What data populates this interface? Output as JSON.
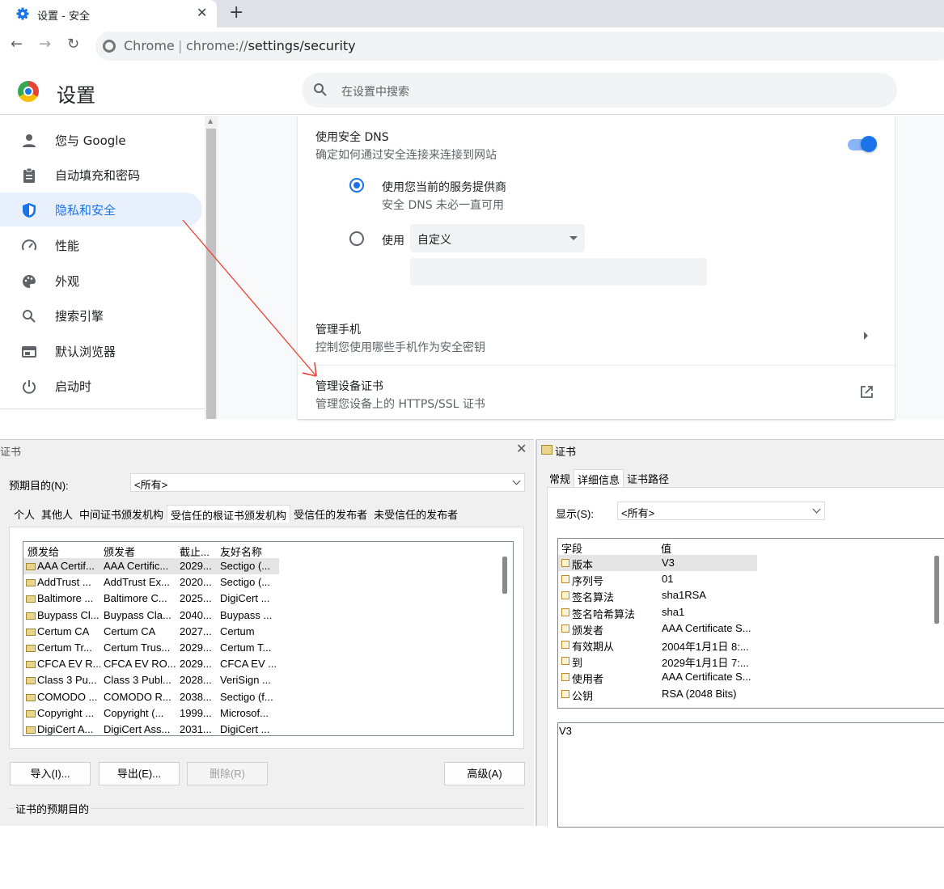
{
  "browser": {
    "tab_title": "设置 - 安全",
    "omnibox_scheme_label": "Chrome",
    "omnibox_url_prefix": "chrome://",
    "omnibox_url_path": "settings/security"
  },
  "settings": {
    "title": "设置",
    "search_placeholder": "在设置中搜索",
    "sidebar": [
      {
        "label": "您与 Google",
        "icon": "person-icon"
      },
      {
        "label": "自动填充和密码",
        "icon": "clipboard-icon"
      },
      {
        "label": "隐私和安全",
        "icon": "shield-icon",
        "active": true
      },
      {
        "label": "性能",
        "icon": "speedometer-icon"
      },
      {
        "label": "外观",
        "icon": "palette-icon"
      },
      {
        "label": "搜索引擎",
        "icon": "search-icon"
      },
      {
        "label": "默认浏览器",
        "icon": "browser-icon"
      },
      {
        "label": "启动时",
        "icon": "power-icon"
      }
    ],
    "secure_dns": {
      "title": "使用安全 DNS",
      "subtitle": "确定如何通过安全连接来连接到网站",
      "enabled": true,
      "option_current": "使用您当前的服务提供商",
      "option_current_note": "安全 DNS 未必一直可用",
      "option_custom_prefix": "使用",
      "option_custom_select": "自定义",
      "custom_input_value": ""
    },
    "manage_phones": {
      "title": "管理手机",
      "subtitle": "控制您使用哪些手机作为安全密钥"
    },
    "manage_certs": {
      "title": "管理设备证书",
      "subtitle": "管理您设备上的 HTTPS/SSL 证书"
    },
    "annotation_arrow_color": "#ea4335"
  },
  "cert_manager": {
    "title": "证书",
    "purpose_label": "预期目的(N):",
    "purpose_value": "<所有>",
    "tabs": [
      "个人",
      "其他人",
      "中间证书颁发机构",
      "受信任的根证书颁发机构",
      "受信任的发布者",
      "未受信任的发布者"
    ],
    "selected_tab": 3,
    "columns": [
      "颁发给",
      "颁发者",
      "截止...",
      "友好名称"
    ],
    "rows": [
      [
        "AAA Certif...",
        "AAA Certific...",
        "2029...",
        "Sectigo (..."
      ],
      [
        "AddTrust ...",
        "AddTrust Ex...",
        "2020...",
        "Sectigo (..."
      ],
      [
        "Baltimore ...",
        "Baltimore C...",
        "2025...",
        "DigiCert ..."
      ],
      [
        "Buypass Cl...",
        "Buypass Cla...",
        "2040...",
        "Buypass ..."
      ],
      [
        "Certum CA",
        "Certum CA",
        "2027...",
        "Certum"
      ],
      [
        "Certum Tr...",
        "Certum Trus...",
        "2029...",
        "Certum T..."
      ],
      [
        "CFCA EV R...",
        "CFCA EV RO...",
        "2029...",
        "CFCA EV ..."
      ],
      [
        "Class 3 Pu...",
        "Class 3 Publ...",
        "2028...",
        "VeriSign ..."
      ],
      [
        "COMODO ...",
        "COMODO R...",
        "2038...",
        "Sectigo (f..."
      ],
      [
        "Copyright ...",
        "Copyright (...",
        "1999...",
        "Microsof..."
      ],
      [
        "DigiCert A...",
        "DigiCert Ass...",
        "2031...",
        "DigiCert ..."
      ]
    ],
    "buttons": {
      "import": "导入(I)...",
      "export": "导出(E)...",
      "remove": "删除(R)",
      "advanced": "高级(A)"
    },
    "purposes_group_label": "证书的预期目的"
  },
  "cert_details": {
    "title": "证书",
    "tabs": [
      "常规",
      "详细信息",
      "证书路径"
    ],
    "selected_tab": 1,
    "show_label": "显示(S):",
    "show_value": "<所有>",
    "columns": [
      "字段",
      "值"
    ],
    "rows": [
      [
        "版本",
        "V3"
      ],
      [
        "序列号",
        "01"
      ],
      [
        "签名算法",
        "sha1RSA"
      ],
      [
        "签名哈希算法",
        "sha1"
      ],
      [
        "颁发者",
        "AAA Certificate S..."
      ],
      [
        "有效期从",
        "2004年1月1日 8:..."
      ],
      [
        "到",
        "2029年1月1日 7:..."
      ],
      [
        "使用者",
        "AAA Certificate S..."
      ],
      [
        "公钥",
        "RSA (2048 Bits)"
      ]
    ],
    "value_text": "V3"
  }
}
